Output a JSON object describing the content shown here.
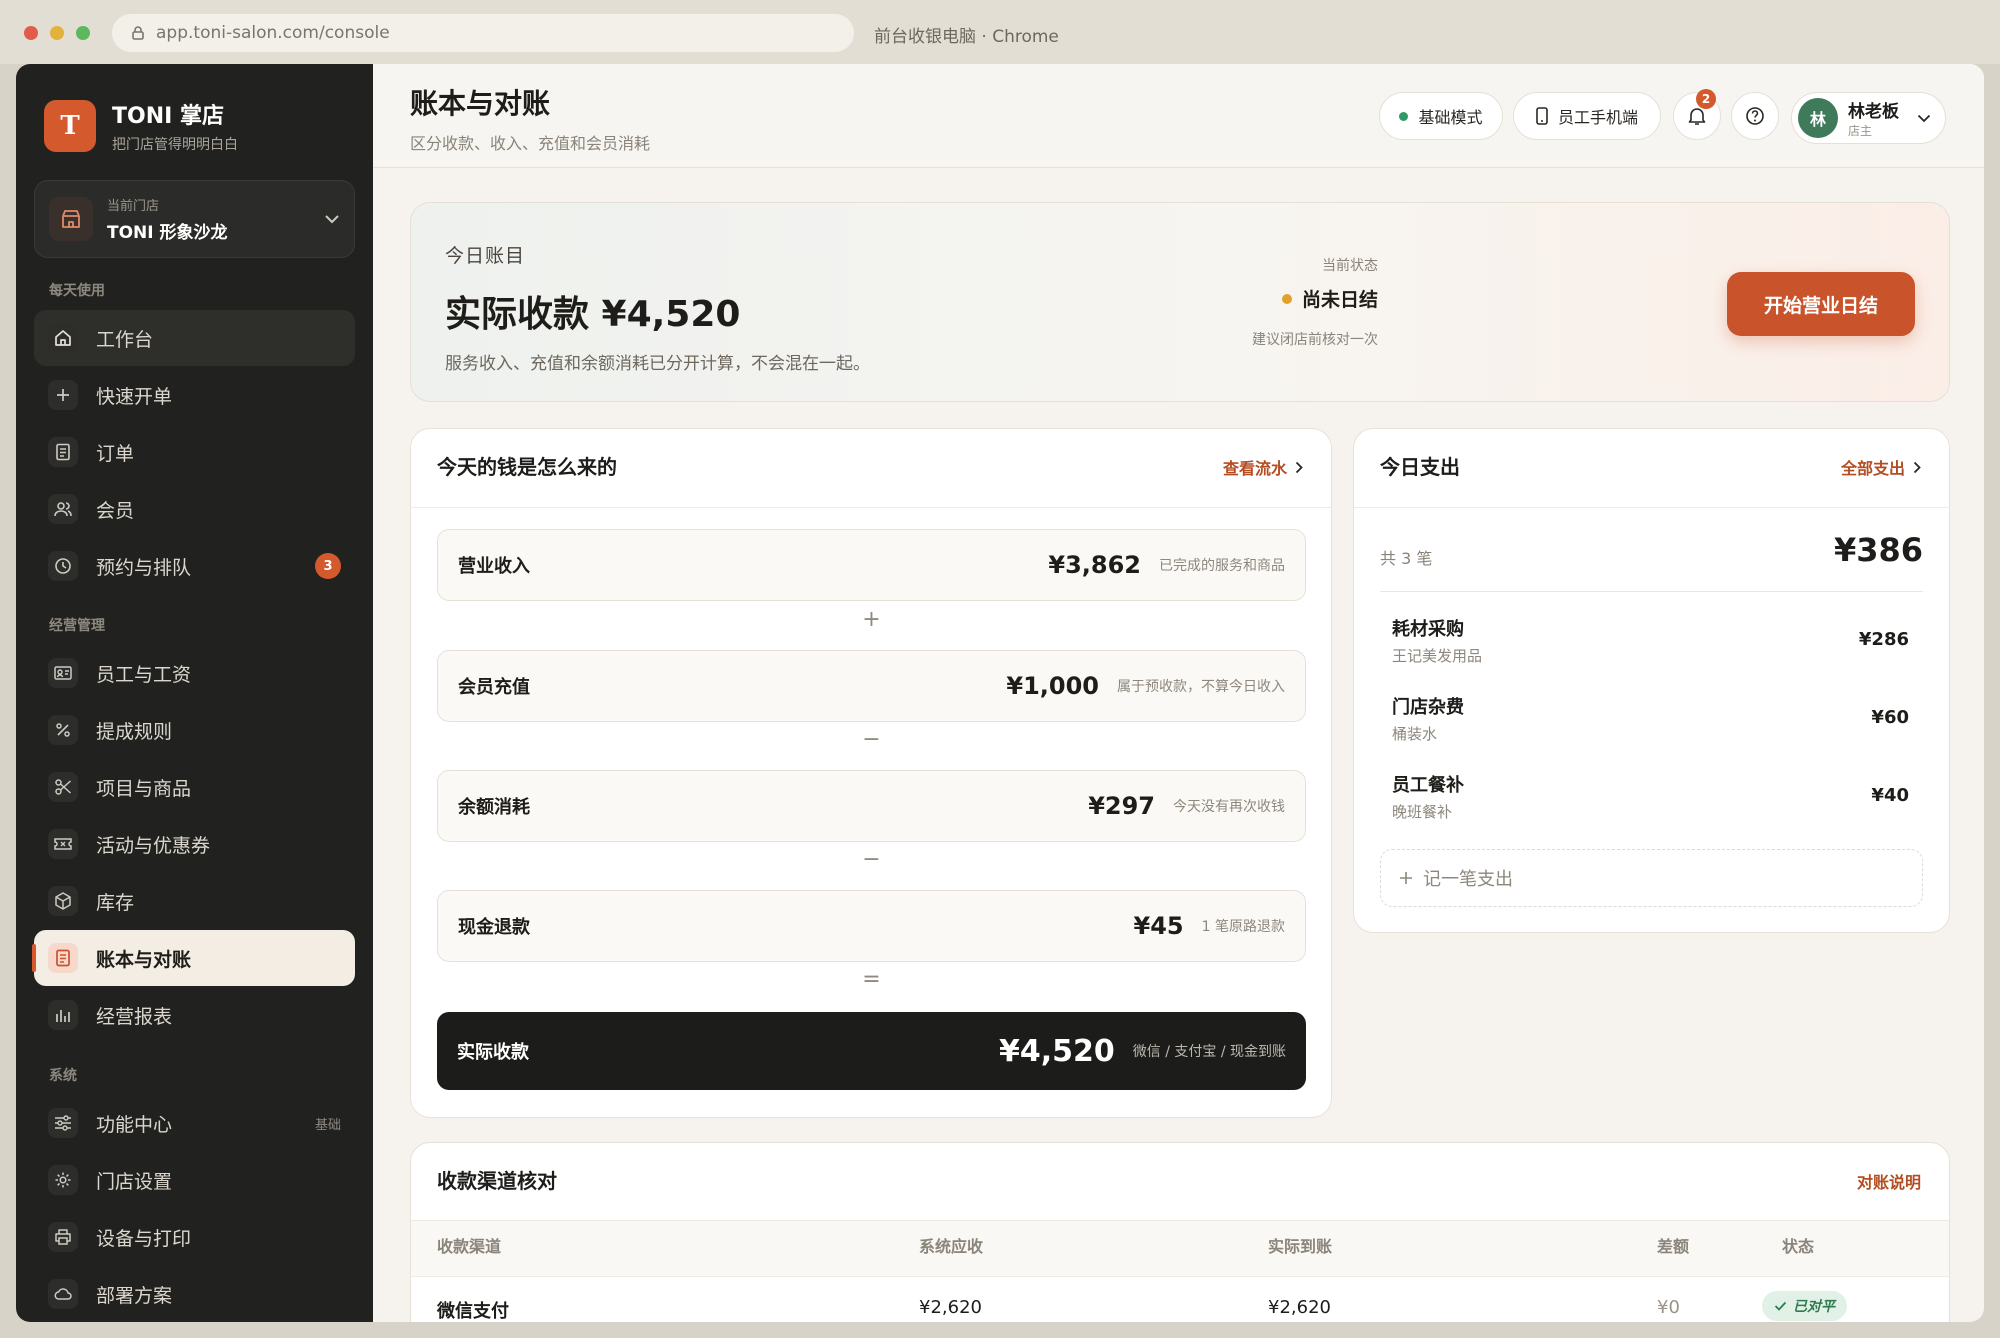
{
  "browser": {
    "url": "app.toni-salon.com/console",
    "window_title": "前台收银电脑 · Chrome"
  },
  "brand": {
    "logo_letter": "T",
    "name": "TONI 掌店",
    "tagline": "把门店管得明明白白"
  },
  "store": {
    "label": "当前门店",
    "name": "TONI 形象沙龙"
  },
  "sidebar": {
    "section_daily": "每天使用",
    "daily": [
      {
        "label": "工作台",
        "icon": "home-icon"
      },
      {
        "label": "快速开单",
        "icon": "plus-icon"
      },
      {
        "label": "订单",
        "icon": "receipt-icon"
      },
      {
        "label": "会员",
        "icon": "users-icon"
      },
      {
        "label": "预约与排队",
        "icon": "clock-icon",
        "badge": "3"
      }
    ],
    "section_ops": "经营管理",
    "ops": [
      {
        "label": "员工与工资",
        "icon": "id-card-icon"
      },
      {
        "label": "提成规则",
        "icon": "percent-icon"
      },
      {
        "label": "项目与商品",
        "icon": "scissors-icon"
      },
      {
        "label": "活动与优惠券",
        "icon": "ticket-icon"
      },
      {
        "label": "库存",
        "icon": "box-icon"
      },
      {
        "label": "账本与对账",
        "icon": "ledger-icon"
      },
      {
        "label": "经营报表",
        "icon": "bar-chart-icon"
      }
    ],
    "section_sys": "系统",
    "sys": [
      {
        "label": "功能中心",
        "icon": "sliders-icon",
        "tag": "基础"
      },
      {
        "label": "门店设置",
        "icon": "gear-icon"
      },
      {
        "label": "设备与打印",
        "icon": "printer-icon"
      },
      {
        "label": "部署方案",
        "icon": "cloud-icon"
      }
    ]
  },
  "header": {
    "title": "账本与对账",
    "subtitle": "区分收款、收入、充值和会员消耗",
    "mode": "基础模式",
    "mobile": "员工手机端",
    "notif_count": "2",
    "user_avatar": "林",
    "user_name": "林老板",
    "user_role": "店主"
  },
  "hero": {
    "label": "今日账目",
    "headline": "实际收款 ¥4,520",
    "note": "服务收入、充值和余额消耗已分开计算，不会混在一起。",
    "status_label": "当前状态",
    "status": "尚未日结",
    "status_note": "建议闭店前核对一次",
    "cta": "开始营业日结"
  },
  "flow": {
    "title": "今天的钱是怎么来的",
    "link": "查看流水",
    "rows": [
      {
        "label": "营业收入",
        "value": "¥3,862",
        "note": "已完成的服务和商品"
      },
      {
        "label": "会员充值",
        "value": "¥1,000",
        "note": "属于预收款，不算今日收入"
      },
      {
        "label": "余额消耗",
        "value": "¥297",
        "note": "今天没有再次收钱"
      },
      {
        "label": "现金退款",
        "value": "¥45",
        "note": "1 笔原路退款"
      },
      {
        "label": "实际收款",
        "value": "¥4,520",
        "note": "微信 / 支付宝 / 现金到账"
      }
    ],
    "ops": [
      "+",
      "−",
      "−",
      "="
    ]
  },
  "expenses": {
    "title": "今日支出",
    "link": "全部支出",
    "count_label": "共 3 笔",
    "total": "¥386",
    "items": [
      {
        "name": "耗材采购",
        "sub": "王记美发用品",
        "amount": "¥286"
      },
      {
        "name": "门店杂费",
        "sub": "桶装水",
        "amount": "¥60"
      },
      {
        "name": "员工餐补",
        "sub": "晚班餐补",
        "amount": "¥40"
      }
    ],
    "add": "记一笔支出"
  },
  "channels": {
    "title": "收款渠道核对",
    "link": "对账说明",
    "columns": [
      "收款渠道",
      "系统应收",
      "实际到账",
      "差额",
      "状态"
    ],
    "rows": [
      {
        "channel": "微信支付",
        "expected": "¥2,620",
        "actual": "¥2,620",
        "diff": "¥0",
        "status": "已对平"
      }
    ]
  },
  "colors": {
    "accent": "#c9532a",
    "sidebar_bg": "#21221f",
    "ok": "#2f7a4f"
  }
}
